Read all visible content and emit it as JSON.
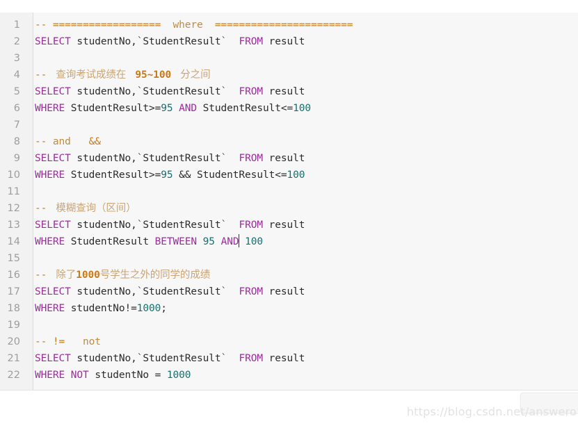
{
  "editor": {
    "language": "sql",
    "theme_background": "#f7f7f7",
    "gutter_background": "#f2f2f2",
    "colors": {
      "keyword": "#9b2d9b",
      "number": "#17706e",
      "identifier": "#2b2b2b",
      "comment": "#c08b3e",
      "comment_accent": "#c87a19",
      "comment_cjk": "#c9a477",
      "line_number": "#9d9d9d"
    },
    "lines": [
      {
        "number": "1",
        "tokens": [
          {
            "t": "-- ",
            "c": "cmt-dash"
          },
          {
            "t": "==================",
            "c": "cmt-dash"
          },
          {
            "t": "  ",
            "c": "cmt"
          },
          {
            "t": "where",
            "c": "cmt"
          },
          {
            "t": "  ",
            "c": "cmt"
          },
          {
            "t": "=======================",
            "c": "cmt-dash"
          }
        ]
      },
      {
        "number": "2",
        "tokens": [
          {
            "t": "SELECT",
            "c": "kw"
          },
          {
            "t": " studentNo,",
            "c": "ident"
          },
          {
            "t": "`",
            "c": "tick"
          },
          {
            "t": "StudentResult",
            "c": "ident"
          },
          {
            "t": "`",
            "c": "tick"
          },
          {
            "t": "  ",
            "c": "ident"
          },
          {
            "t": "FROM",
            "c": "kw"
          },
          {
            "t": " result",
            "c": "ident"
          }
        ]
      },
      {
        "number": "3",
        "tokens": []
      },
      {
        "number": "4",
        "tokens": [
          {
            "t": "-- ",
            "c": "cmt-dash"
          },
          {
            "t": " 查询考试成绩在 ",
            "c": "cmt-cjk"
          },
          {
            "t": " 95~100 ",
            "c": "cmt-em"
          },
          {
            "t": " 分之间",
            "c": "cmt-cjk"
          }
        ]
      },
      {
        "number": "5",
        "tokens": [
          {
            "t": "SELECT",
            "c": "kw"
          },
          {
            "t": " studentNo,",
            "c": "ident"
          },
          {
            "t": "`",
            "c": "tick"
          },
          {
            "t": "StudentResult",
            "c": "ident"
          },
          {
            "t": "`",
            "c": "tick"
          },
          {
            "t": "  ",
            "c": "ident"
          },
          {
            "t": "FROM",
            "c": "kw"
          },
          {
            "t": " result",
            "c": "ident"
          }
        ]
      },
      {
        "number": "6",
        "tokens": [
          {
            "t": "WHERE",
            "c": "kw"
          },
          {
            "t": " StudentResult>=",
            "c": "ident"
          },
          {
            "t": "95",
            "c": "num"
          },
          {
            "t": " ",
            "c": "ident"
          },
          {
            "t": "AND",
            "c": "kw"
          },
          {
            "t": " StudentResult<=",
            "c": "ident"
          },
          {
            "t": "100",
            "c": "num"
          }
        ]
      },
      {
        "number": "7",
        "tokens": []
      },
      {
        "number": "8",
        "tokens": [
          {
            "t": "-- ",
            "c": "cmt-dash"
          },
          {
            "t": "and",
            "c": "cmt"
          },
          {
            "t": "   ",
            "c": "cmt"
          },
          {
            "t": "&&",
            "c": "cmt-dash"
          }
        ]
      },
      {
        "number": "9",
        "tokens": [
          {
            "t": "SELECT",
            "c": "kw"
          },
          {
            "t": " studentNo,",
            "c": "ident"
          },
          {
            "t": "`",
            "c": "tick"
          },
          {
            "t": "StudentResult",
            "c": "ident"
          },
          {
            "t": "`",
            "c": "tick"
          },
          {
            "t": "  ",
            "c": "ident"
          },
          {
            "t": "FROM",
            "c": "kw"
          },
          {
            "t": " result",
            "c": "ident"
          }
        ]
      },
      {
        "number": "10",
        "tokens": [
          {
            "t": "WHERE",
            "c": "kw"
          },
          {
            "t": " StudentResult>=",
            "c": "ident"
          },
          {
            "t": "95",
            "c": "num"
          },
          {
            "t": " && StudentResult<=",
            "c": "ident"
          },
          {
            "t": "100",
            "c": "num"
          }
        ]
      },
      {
        "number": "11",
        "tokens": []
      },
      {
        "number": "12",
        "tokens": [
          {
            "t": "-- ",
            "c": "cmt-dash"
          },
          {
            "t": " 模糊查询（区间）",
            "c": "cmt-cjk"
          }
        ]
      },
      {
        "number": "13",
        "tokens": [
          {
            "t": "SELECT",
            "c": "kw"
          },
          {
            "t": " studentNo,",
            "c": "ident"
          },
          {
            "t": "`",
            "c": "tick"
          },
          {
            "t": "StudentResult",
            "c": "ident"
          },
          {
            "t": "`",
            "c": "tick"
          },
          {
            "t": "  ",
            "c": "ident"
          },
          {
            "t": "FROM",
            "c": "kw"
          },
          {
            "t": " result",
            "c": "ident"
          }
        ]
      },
      {
        "number": "14",
        "tokens": [
          {
            "t": "WHERE",
            "c": "kw"
          },
          {
            "t": " StudentResult ",
            "c": "ident"
          },
          {
            "t": "BETWEEN",
            "c": "kw"
          },
          {
            "t": " ",
            "c": "ident"
          },
          {
            "t": "95",
            "c": "num"
          },
          {
            "t": " ",
            "c": "ident"
          },
          {
            "t": "AND",
            "c": "kw",
            "caret_after": true
          },
          {
            "t": " ",
            "c": "ident"
          },
          {
            "t": "100",
            "c": "num"
          }
        ]
      },
      {
        "number": "15",
        "tokens": []
      },
      {
        "number": "16",
        "tokens": [
          {
            "t": "-- ",
            "c": "cmt-dash"
          },
          {
            "t": " 除了",
            "c": "cmt-cjk"
          },
          {
            "t": "1000",
            "c": "cmt-em"
          },
          {
            "t": "号学生之外的同学的成绩",
            "c": "cmt-cjk"
          }
        ]
      },
      {
        "number": "17",
        "tokens": [
          {
            "t": "SELECT",
            "c": "kw"
          },
          {
            "t": " studentNo,",
            "c": "ident"
          },
          {
            "t": "`",
            "c": "tick"
          },
          {
            "t": "StudentResult",
            "c": "ident"
          },
          {
            "t": "`",
            "c": "tick"
          },
          {
            "t": "  ",
            "c": "ident"
          },
          {
            "t": "FROM",
            "c": "kw"
          },
          {
            "t": " result",
            "c": "ident"
          }
        ]
      },
      {
        "number": "18",
        "tokens": [
          {
            "t": "WHERE",
            "c": "kw"
          },
          {
            "t": " studentNo!=",
            "c": "ident"
          },
          {
            "t": "1000",
            "c": "num"
          },
          {
            "t": ";",
            "c": "ident"
          }
        ]
      },
      {
        "number": "19",
        "tokens": []
      },
      {
        "number": "20",
        "tokens": [
          {
            "t": "-- ",
            "c": "cmt-dash"
          },
          {
            "t": "!=",
            "c": "cmt-dash"
          },
          {
            "t": "   ",
            "c": "cmt"
          },
          {
            "t": "not",
            "c": "cmt"
          }
        ]
      },
      {
        "number": "21",
        "tokens": [
          {
            "t": "SELECT",
            "c": "kw"
          },
          {
            "t": " studentNo,",
            "c": "ident"
          },
          {
            "t": "`",
            "c": "tick"
          },
          {
            "t": "StudentResult",
            "c": "ident"
          },
          {
            "t": "`",
            "c": "tick"
          },
          {
            "t": "  ",
            "c": "ident"
          },
          {
            "t": "FROM",
            "c": "kw"
          },
          {
            "t": " result",
            "c": "ident"
          }
        ]
      },
      {
        "number": "22",
        "tokens": [
          {
            "t": "WHERE",
            "c": "kw"
          },
          {
            "t": " ",
            "c": "ident"
          },
          {
            "t": "NOT",
            "c": "kw"
          },
          {
            "t": " studentNo = ",
            "c": "ident"
          },
          {
            "t": "1000",
            "c": "num"
          }
        ]
      }
    ]
  },
  "watermark": {
    "text": "https://blog.csdn.net/answero"
  },
  "status_chip": {
    "label": ""
  }
}
